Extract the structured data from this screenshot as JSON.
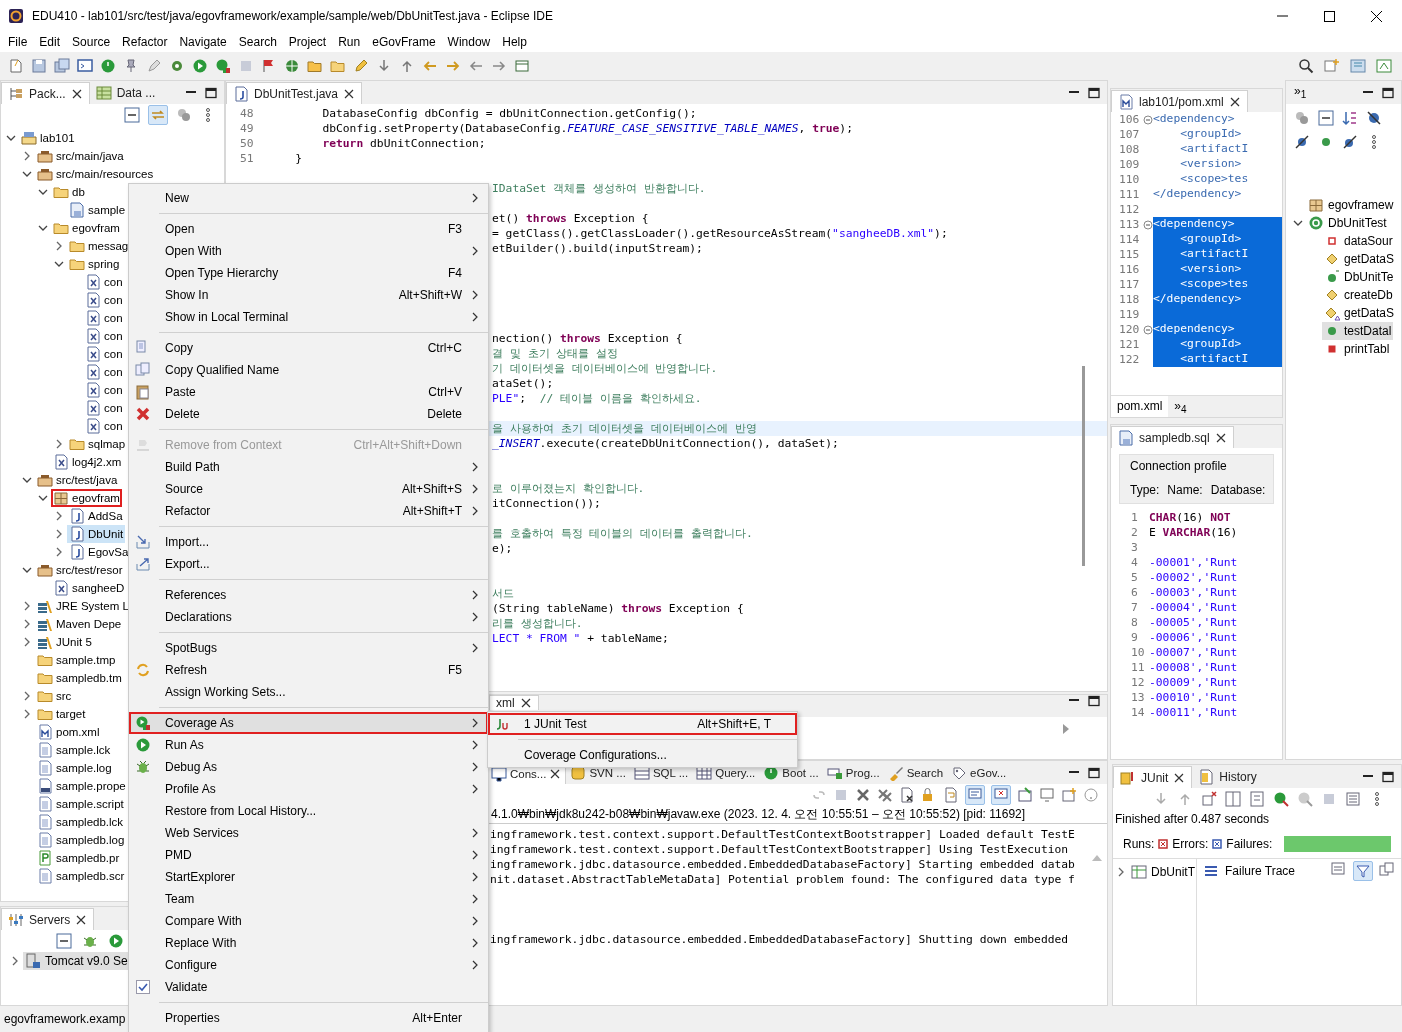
{
  "window": {
    "title": "EDU410 - lab101/src/test/java/egovframework/example/sample/web/DbUnitTest.java - Eclipse IDE"
  },
  "menu_bar": [
    "File",
    "Edit",
    "Source",
    "Refactor",
    "Navigate",
    "Search",
    "Project",
    "Run",
    "eGovFrame",
    "Window",
    "Help"
  ],
  "package_explorer": {
    "tabs": [
      {
        "label": "Pack...",
        "selected": true
      },
      {
        "label": "Data ...",
        "selected": false
      }
    ],
    "tree": [
      {
        "label": "lab101",
        "kind": "project",
        "expanded": true,
        "selected": false,
        "highlighted": false,
        "children": [
          {
            "label": "src/main/java",
            "kind": "srcfolder",
            "expanded": false,
            "selected": false,
            "highlighted": false
          },
          {
            "label": "src/main/resources",
            "kind": "srcfolder",
            "expanded": true,
            "selected": false,
            "highlighted": false,
            "children": [
              {
                "label": "db",
                "kind": "folder",
                "expanded": true,
                "selected": false,
                "highlighted": false,
                "children": [
                  {
                    "label": "sample",
                    "kind": "dbfile",
                    "selected": false,
                    "highlighted": false
                  }
                ]
              },
              {
                "label": "egovfram",
                "kind": "folder",
                "expanded": true,
                "selected": false,
                "highlighted": false,
                "children": [
                  {
                    "label": "messag",
                    "kind": "folder",
                    "expanded": false,
                    "selected": false,
                    "highlighted": false
                  },
                  {
                    "label": "spring",
                    "kind": "folder",
                    "expanded": true,
                    "selected": false,
                    "highlighted": false,
                    "children": [
                      {
                        "label": "con",
                        "kind": "xml",
                        "selected": false,
                        "highlighted": false
                      },
                      {
                        "label": "con",
                        "kind": "xml",
                        "selected": false,
                        "highlighted": false
                      },
                      {
                        "label": "con",
                        "kind": "xml",
                        "selected": false,
                        "highlighted": false
                      },
                      {
                        "label": "con",
                        "kind": "xml",
                        "selected": false,
                        "highlighted": false
                      },
                      {
                        "label": "con",
                        "kind": "xml",
                        "selected": false,
                        "highlighted": false
                      },
                      {
                        "label": "con",
                        "kind": "xml",
                        "selected": false,
                        "highlighted": false
                      },
                      {
                        "label": "con",
                        "kind": "xml",
                        "selected": false,
                        "highlighted": false
                      },
                      {
                        "label": "con",
                        "kind": "xml",
                        "selected": false,
                        "highlighted": false
                      },
                      {
                        "label": "con",
                        "kind": "xml",
                        "selected": false,
                        "highlighted": false
                      }
                    ]
                  },
                  {
                    "label": "sqlmap",
                    "kind": "folder",
                    "expanded": false,
                    "selected": false,
                    "highlighted": false
                  }
                ]
              },
              {
                "label": "log4j2.xm",
                "kind": "xml",
                "selected": false,
                "highlighted": false
              }
            ]
          },
          {
            "label": "src/test/java",
            "kind": "srcfolder",
            "expanded": true,
            "selected": false,
            "highlighted": false,
            "children": [
              {
                "label": "egovfram",
                "kind": "package",
                "expanded": true,
                "selected": false,
                "highlighted": true,
                "children": [
                  {
                    "label": "AddSa",
                    "kind": "java",
                    "expanded": false,
                    "selected": false,
                    "highlighted": false
                  },
                  {
                    "label": "DbUnit",
                    "kind": "java",
                    "expanded": false,
                    "selected": true,
                    "highlighted": false
                  },
                  {
                    "label": "EgovSa",
                    "kind": "java",
                    "expanded": false,
                    "selected": false,
                    "highlighted": false
                  }
                ]
              }
            ]
          },
          {
            "label": "src/test/resor",
            "kind": "srcfolder",
            "expanded": true,
            "selected": false,
            "highlighted": false,
            "children": [
              {
                "label": "sangheeD",
                "kind": "xml",
                "selected": false,
                "highlighted": false
              }
            ]
          },
          {
            "label": "JRE System L",
            "kind": "library",
            "expanded": false,
            "selected": false,
            "highlighted": false
          },
          {
            "label": "Maven Depe",
            "kind": "library",
            "expanded": false,
            "selected": false,
            "highlighted": false
          },
          {
            "label": "JUnit 5",
            "kind": "library",
            "expanded": false,
            "selected": false,
            "highlighted": false
          },
          {
            "label": "sample.tmp",
            "kind": "folder",
            "selected": false,
            "highlighted": false
          },
          {
            "label": "sampledb.tm",
            "kind": "folder",
            "selected": false,
            "highlighted": false
          },
          {
            "label": "src",
            "kind": "folder",
            "expanded": false,
            "selected": false,
            "highlighted": false
          },
          {
            "label": "target",
            "kind": "folder",
            "expanded": false,
            "selected": false,
            "highlighted": false
          },
          {
            "label": "pom.xml",
            "kind": "pom",
            "selected": false,
            "highlighted": false
          },
          {
            "label": "sample.lck",
            "kind": "file",
            "selected": false,
            "highlighted": false
          },
          {
            "label": "sample.log",
            "kind": "file",
            "selected": false,
            "highlighted": false
          },
          {
            "label": "sample.prope",
            "kind": "binary",
            "selected": false,
            "highlighted": false
          },
          {
            "label": "sample.script",
            "kind": "file",
            "selected": false,
            "highlighted": false
          },
          {
            "label": "sampledb.lck",
            "kind": "file",
            "selected": false,
            "highlighted": false
          },
          {
            "label": "sampledb.log",
            "kind": "file",
            "selected": false,
            "highlighted": false
          },
          {
            "label": "sampledb.pr",
            "kind": "pfile",
            "selected": false,
            "highlighted": false
          },
          {
            "label": "sampledb.scr",
            "kind": "file",
            "selected": false,
            "highlighted": false
          }
        ]
      }
    ]
  },
  "servers": {
    "tab": "Servers",
    "items": [
      {
        "label": "Tomcat v9.0 Se",
        "selected": true
      }
    ]
  },
  "editor": {
    "tab": "DbUnitTest.java",
    "lines": [
      {
        "number": "48",
        "current": false,
        "segments": [
          {
            "kind": "plain",
            "text": "        DatabaseConfig "
          },
          {
            "kind": "var",
            "text": "dbConfig"
          },
          {
            "kind": "plain",
            "text": " = "
          },
          {
            "kind": "var",
            "text": "dbUnitConnection"
          },
          {
            "kind": "plain",
            "text": ".getConfig();"
          }
        ]
      },
      {
        "number": "49",
        "current": false,
        "segments": [
          {
            "kind": "var",
            "text": "        dbConfig"
          },
          {
            "kind": "plain",
            "text": ".setProperty(DatabaseConfig."
          },
          {
            "kind": "const",
            "text": "FEATURE_CASE_SENSITIVE_TABLE_NAMES"
          },
          {
            "kind": "plain",
            "text": ", "
          },
          {
            "kind": "kw",
            "text": "true"
          },
          {
            "kind": "plain",
            "text": ");"
          }
        ]
      },
      {
        "number": "50",
        "current": false,
        "segments": [
          {
            "kind": "kw",
            "text": "        return "
          },
          {
            "kind": "var",
            "text": "dbUnitConnection"
          },
          {
            "kind": "plain",
            "text": ";"
          }
        ]
      },
      {
        "number": "51",
        "current": false,
        "segments": [
          {
            "kind": "plain",
            "text": "    }"
          }
        ]
      },
      {
        "current": false
      },
      {
        "current": false,
        "segments": [
          {
            "kind": "comment",
            "text": "IDataSet 객체를 생성하여 반환합니다."
          }
        ]
      },
      {
        "current": false
      },
      {
        "current": false,
        "segments": [
          {
            "kind": "plain",
            "text": "et() "
          },
          {
            "kind": "kw",
            "text": "throws"
          },
          {
            "kind": "plain",
            "text": " Exception {"
          }
        ]
      },
      {
        "current": false,
        "segments": [
          {
            "kind": "plain",
            "text": "= getClass().getClassLoader().getResourceAsStream("
          },
          {
            "kind": "str",
            "text": "\"sangheeDB.xml\""
          },
          {
            "kind": "plain",
            "text": ");"
          }
        ]
      },
      {
        "current": false,
        "segments": [
          {
            "kind": "plain",
            "text": "etBuilder().build("
          },
          {
            "kind": "var",
            "text": "inputStream"
          },
          {
            "kind": "plain",
            "text": ");"
          }
        ]
      },
      {
        "current": false
      },
      {
        "current": false
      },
      {
        "current": false
      },
      {
        "current": false
      },
      {
        "current": false
      },
      {
        "current": false,
        "segments": [
          {
            "kind": "plain",
            "text": "nection() "
          },
          {
            "kind": "kw",
            "text": "throws"
          },
          {
            "kind": "plain",
            "text": " Exception {"
          }
        ]
      },
      {
        "current": false,
        "segments": [
          {
            "kind": "comment",
            "text": "결 및 초기 상태를 설정"
          }
        ]
      },
      {
        "current": false,
        "segments": [
          {
            "kind": "comment",
            "text": "기 데이터셋을 데이터베이스에 반영합니다."
          }
        ]
      },
      {
        "current": false,
        "segments": [
          {
            "kind": "plain",
            "text": "ataSet();"
          }
        ]
      },
      {
        "current": false,
        "segments": [
          {
            "kind": "str",
            "text": "PLE\""
          },
          {
            "kind": "plain",
            "text": ";  "
          },
          {
            "kind": "comment",
            "text": "// 테이블 이름을 확인하세요."
          }
        ]
      },
      {
        "current": false
      },
      {
        "current": true,
        "segments": [
          {
            "kind": "comment",
            "text": "을 사용하여 초기 데이터셋을 데이터베이스에 반영"
          }
        ]
      },
      {
        "current": false,
        "segments": [
          {
            "kind": "const",
            "text": "_INSERT"
          },
          {
            "kind": "plain",
            "text": ".execute(createDbUnitConnection(), "
          },
          {
            "kind": "var",
            "text": "dataSet"
          },
          {
            "kind": "plain",
            "text": ");"
          }
        ]
      },
      {
        "current": false
      },
      {
        "current": false
      },
      {
        "current": false,
        "segments": [
          {
            "kind": "comment",
            "text": "로 이루어졌는지 확인합니다."
          }
        ]
      },
      {
        "current": false,
        "segments": [
          {
            "kind": "plain",
            "text": "itConnection());"
          }
        ]
      },
      {
        "current": false
      },
      {
        "current": false,
        "segments": [
          {
            "kind": "comment",
            "text": "를 호출하여 특정 테이블의 데이터를 출력합니다."
          }
        ]
      },
      {
        "current": false,
        "segments": [
          {
            "kind": "plain",
            "text": "e);"
          }
        ]
      },
      {
        "current": false
      },
      {
        "current": false
      },
      {
        "current": false,
        "segments": [
          {
            "kind": "comment",
            "text": "서드"
          }
        ]
      },
      {
        "current": false,
        "segments": [
          {
            "kind": "plain",
            "text": "(String "
          },
          {
            "kind": "var",
            "text": "tableName"
          },
          {
            "kind": "plain",
            "text": ") "
          },
          {
            "kind": "kw",
            "text": "throws"
          },
          {
            "kind": "plain",
            "text": " Exception {"
          }
        ]
      },
      {
        "current": false,
        "segments": [
          {
            "kind": "comment",
            "text": "리를 생성합니다."
          }
        ]
      },
      {
        "current": false,
        "segments": [
          {
            "kind": "str",
            "text": "LECT * FROM \""
          },
          {
            "kind": "plain",
            "text": " + "
          },
          {
            "kind": "var",
            "text": "tableName"
          },
          {
            "kind": "plain",
            "text": ";"
          }
        ]
      }
    ]
  },
  "lower_editor": {
    "tab": "xml"
  },
  "pom_editor": {
    "tab": "lab101/pom.xml",
    "lines": [
      {
        "number": "106",
        "text": "<dependency>",
        "selected": false,
        "folding": true
      },
      {
        "number": "107",
        "text": "    <groupId>",
        "selected": false,
        "folding": false
      },
      {
        "number": "108",
        "text": "    <artifactI",
        "selected": false,
        "folding": false
      },
      {
        "number": "109",
        "text": "    <version>",
        "selected": false,
        "folding": false
      },
      {
        "number": "110",
        "text": "    <scope>tes",
        "selected": false,
        "folding": false
      },
      {
        "number": "111",
        "text": "</dependency>",
        "selected": false,
        "folding": false
      },
      {
        "number": "112",
        "selected": false,
        "folding": false
      },
      {
        "number": "113",
        "text": "<dependency>",
        "selected": true,
        "folding": true
      },
      {
        "number": "114",
        "text": "    <groupId>",
        "selected": true,
        "folding": false
      },
      {
        "number": "115",
        "text": "    <artifactI",
        "selected": true,
        "folding": false
      },
      {
        "number": "116",
        "text": "    <version>",
        "selected": true,
        "folding": false
      },
      {
        "number": "117",
        "text": "    <scope>tes",
        "selected": true,
        "folding": false
      },
      {
        "number": "118",
        "text": "</dependency>",
        "selected": true,
        "folding": false
      },
      {
        "number": "119",
        "selected": true,
        "folding": false
      },
      {
        "number": "120",
        "text": "<dependency>",
        "selected": true,
        "folding": true
      },
      {
        "number": "121",
        "text": "    <groupId>",
        "selected": true,
        "folding": false
      },
      {
        "number": "122",
        "text": "    <artifactI",
        "selected": true,
        "folding": false
      }
    ],
    "bottom_tabs": [
      {
        "label": "pom.xml",
        "selected": true
      },
      {
        "label": "»$_{4}$",
        "selected": false
      }
    ]
  },
  "sql_editor": {
    "tab": "sampledb.sql",
    "connection_profile": {
      "title": "Connection profile",
      "fields": [
        "Type:",
        "Name:",
        "Database:"
      ]
    },
    "lines": [
      {
        "number": "1",
        "segments": [
          {
            "kind": "kw",
            "text": "CHAR"
          },
          {
            "kind": "plain",
            "text": "(16) "
          },
          {
            "kind": "kw",
            "text": "NOT"
          }
        ]
      },
      {
        "number": "2",
        "segments": [
          {
            "kind": "plain",
            "text": "E "
          },
          {
            "kind": "kw",
            "text": "VARCHAR"
          },
          {
            "kind": "plain",
            "text": "(16)"
          }
        ]
      },
      {
        "number": "3"
      },
      {
        "number": "4",
        "segments": [
          {
            "kind": "str",
            "text": "-00001','Runt"
          }
        ]
      },
      {
        "number": "5",
        "segments": [
          {
            "kind": "str",
            "text": "-00002','Runt"
          }
        ]
      },
      {
        "number": "6",
        "segments": [
          {
            "kind": "str",
            "text": "-00003','Runt"
          }
        ]
      },
      {
        "number": "7",
        "segments": [
          {
            "kind": "str",
            "text": "-00004','Runt"
          }
        ]
      },
      {
        "number": "8",
        "segments": [
          {
            "kind": "str",
            "text": "-00005','Runt"
          }
        ]
      },
      {
        "number": "9",
        "segments": [
          {
            "kind": "str",
            "text": "-00006','Runt"
          }
        ]
      },
      {
        "number": "10",
        "segments": [
          {
            "kind": "str",
            "text": "-00007','Runt"
          }
        ]
      },
      {
        "number": "11",
        "segments": [
          {
            "kind": "str",
            "text": "-00008','Runt"
          }
        ]
      },
      {
        "number": "12",
        "segments": [
          {
            "kind": "str",
            "text": "-00009','Runt"
          }
        ]
      },
      {
        "number": "13",
        "segments": [
          {
            "kind": "str",
            "text": "-00010','Runt"
          }
        ]
      },
      {
        "number": "14",
        "segments": [
          {
            "kind": "str",
            "text": "-00011','Runt"
          }
        ]
      }
    ]
  },
  "outline": {
    "tab": "»$_{1}$",
    "items": [
      {
        "label": "egovframew",
        "kind": "package",
        "selected": false
      },
      {
        "label": "DbUnitTest",
        "kind": "class",
        "expanded": true,
        "selected": false,
        "children": [
          {
            "label": "dataSour",
            "kind": "field",
            "selected": false
          },
          {
            "label": "getDataS",
            "kind": "method",
            "selected": false
          },
          {
            "label": "DbUnitTe",
            "kind": "constructor",
            "selected": false
          },
          {
            "label": "createDb",
            "kind": "method",
            "selected": false
          },
          {
            "label": "getDataS",
            "kind": "abstract",
            "selected": false
          },
          {
            "label": "testDatal",
            "kind": "public",
            "selected": true
          },
          {
            "label": "printTabl",
            "kind": "private",
            "selected": false
          }
        ]
      }
    ]
  },
  "console": {
    "tabs": [
      {
        "label": "Cons...",
        "selected": true
      },
      {
        "label": "SVN ...",
        "selected": false
      },
      {
        "label": "SQL ...",
        "selected": false
      },
      {
        "label": "Query...",
        "selected": false
      },
      {
        "label": "Boot ...",
        "selected": false
      },
      {
        "label": "Prog...",
        "selected": false
      },
      {
        "label": "Search",
        "selected": false
      },
      {
        "label": "eGov...",
        "selected": false
      }
    ],
    "header": "4.1.0₩bin₩jdk8u242-b08₩bin₩javaw.exe  (2023. 12. 4. 오전 10:55:51 – 오전 10:55:52) [pid: 11692]",
    "lines": [
      {
        "text": "ingframework.test.context.support.DefaultTestContextBootstrapper] Loaded default TestE"
      },
      {
        "text": "ingframework.test.context.support.DefaultTestContextBootstrapper] Using TestExecution"
      },
      {
        "text": "ingframework.jdbc.datasource.embedded.EmbeddedDatabaseFactory] Starting embedded datab"
      },
      {
        "text": "nit.dataset.AbstractTableMetaData] Potential problem found: The configured data type f"
      }
    ],
    "later_lines": [
      {
        "text": "ingframework.jdbc.datasource.embedded.EmbeddedDatabaseFactory] Shutting down embedded"
      }
    ]
  },
  "junit": {
    "tabs": [
      {
        "label": "JUnit",
        "selected": true
      },
      {
        "label": "History",
        "selected": false
      }
    ],
    "status": "Finished after 0.487 seconds",
    "runs_label": "Runs:",
    "errors_label": "Errors:",
    "failures_label": "Failures:",
    "level": 1,
    "tree": [
      {
        "label": "DbUnitT",
        "expanded": false
      }
    ],
    "failure_trace": "Failure Trace"
  },
  "context_menu": {
    "items": [
      {
        "kind": "item",
        "label": "New",
        "submenu": true,
        "disabled": false,
        "selected": false,
        "highlighted": false
      },
      {
        "kind": "separator"
      },
      {
        "kind": "item",
        "label": "Open",
        "shortcut": "F3",
        "submenu": false,
        "disabled": false,
        "selected": false,
        "highlighted": false
      },
      {
        "kind": "item",
        "label": "Open With",
        "submenu": true,
        "disabled": false,
        "selected": false,
        "highlighted": false
      },
      {
        "kind": "item",
        "label": "Open Type Hierarchy",
        "shortcut": "F4",
        "submenu": false,
        "disabled": false,
        "selected": false,
        "highlighted": false
      },
      {
        "kind": "item",
        "label": "Show In",
        "shortcut": "Alt+Shift+W",
        "submenu": true,
        "disabled": false,
        "selected": false,
        "highlighted": false
      },
      {
        "kind": "item",
        "label": "Show in Local Terminal",
        "submenu": true,
        "disabled": false,
        "selected": false,
        "highlighted": false
      },
      {
        "kind": "separator"
      },
      {
        "kind": "item",
        "label": "Copy",
        "shortcut": "Ctrl+C",
        "submenu": false,
        "disabled": false,
        "selected": false,
        "highlighted": false
      },
      {
        "kind": "item",
        "label": "Copy Qualified Name",
        "submenu": false,
        "disabled": false,
        "selected": false,
        "highlighted": false
      },
      {
        "kind": "item",
        "label": "Paste",
        "shortcut": "Ctrl+V",
        "submenu": false,
        "disabled": false,
        "selected": false,
        "highlighted": false
      },
      {
        "kind": "item",
        "label": "Delete",
        "shortcut": "Delete",
        "submenu": false,
        "disabled": false,
        "selected": false,
        "highlighted": false
      },
      {
        "kind": "separator"
      },
      {
        "kind": "item",
        "label": "Remove from Context",
        "shortcut": "Ctrl+Alt+Shift+Down",
        "submenu": false,
        "disabled": true,
        "selected": false,
        "highlighted": false
      },
      {
        "kind": "item",
        "label": "Build Path",
        "submenu": true,
        "disabled": false,
        "selected": false,
        "highlighted": false
      },
      {
        "kind": "item",
        "label": "Source",
        "shortcut": "Alt+Shift+S",
        "submenu": true,
        "disabled": false,
        "selected": false,
        "highlighted": false
      },
      {
        "kind": "item",
        "label": "Refactor",
        "shortcut": "Alt+Shift+T",
        "submenu": true,
        "disabled": false,
        "selected": false,
        "highlighted": false
      },
      {
        "kind": "separator"
      },
      {
        "kind": "item",
        "label": "Import...",
        "submenu": false,
        "disabled": false,
        "selected": false,
        "highlighted": false
      },
      {
        "kind": "item",
        "label": "Export...",
        "submenu": false,
        "disabled": false,
        "selected": false,
        "highlighted": false
      },
      {
        "kind": "separator"
      },
      {
        "kind": "item",
        "label": "References",
        "submenu": true,
        "disabled": false,
        "selected": false,
        "highlighted": false
      },
      {
        "kind": "item",
        "label": "Declarations",
        "submenu": true,
        "disabled": false,
        "selected": false,
        "highlighted": false
      },
      {
        "kind": "separator"
      },
      {
        "kind": "item",
        "label": "SpotBugs",
        "submenu": true,
        "disabled": false,
        "selected": false,
        "highlighted": false
      },
      {
        "kind": "item",
        "label": "Refresh",
        "shortcut": "F5",
        "submenu": false,
        "disabled": false,
        "selected": false,
        "highlighted": false
      },
      {
        "kind": "item",
        "label": "Assign Working Sets...",
        "submenu": false,
        "disabled": false,
        "selected": false,
        "highlighted": false
      },
      {
        "kind": "separator"
      },
      {
        "kind": "item",
        "label": "Coverage As",
        "submenu": true,
        "disabled": false,
        "selected": true,
        "highlighted": true
      },
      {
        "kind": "item",
        "label": "Run As",
        "submenu": true,
        "disabled": false,
        "selected": false,
        "highlighted": false
      },
      {
        "kind": "item",
        "label": "Debug As",
        "submenu": true,
        "disabled": false,
        "selected": false,
        "highlighted": false
      },
      {
        "kind": "item",
        "label": "Profile As",
        "submenu": true,
        "disabled": false,
        "selected": false,
        "highlighted": false
      },
      {
        "kind": "item",
        "label": "Restore from Local History...",
        "submenu": false,
        "disabled": false,
        "selected": false,
        "highlighted": false
      },
      {
        "kind": "item",
        "label": "Web Services",
        "submenu": true,
        "disabled": false,
        "selected": false,
        "highlighted": false
      },
      {
        "kind": "item",
        "label": "PMD",
        "submenu": true,
        "disabled": false,
        "selected": false,
        "highlighted": false
      },
      {
        "kind": "item",
        "label": "StartExplorer",
        "submenu": true,
        "disabled": false,
        "selected": false,
        "highlighted": false
      },
      {
        "kind": "item",
        "label": "Team",
        "submenu": true,
        "disabled": false,
        "selected": false,
        "highlighted": false
      },
      {
        "kind": "item",
        "label": "Compare With",
        "submenu": true,
        "disabled": false,
        "selected": false,
        "highlighted": false
      },
      {
        "kind": "item",
        "label": "Replace With",
        "submenu": true,
        "disabled": false,
        "selected": false,
        "highlighted": false
      },
      {
        "kind": "item",
        "label": "Configure",
        "submenu": true,
        "disabled": false,
        "selected": false,
        "highlighted": false
      },
      {
        "kind": "item",
        "label": "Validate",
        "submenu": false,
        "disabled": false,
        "selected": false,
        "highlighted": false
      },
      {
        "kind": "separator"
      },
      {
        "kind": "item",
        "label": "Properties",
        "shortcut": "Alt+Enter",
        "submenu": false,
        "disabled": false,
        "selected": false,
        "highlighted": false
      }
    ]
  },
  "submenu": {
    "items": [
      {
        "kind": "item",
        "label": "1 JUnit Test",
        "shortcut": "Alt+Shift+E, T",
        "highlighted": true
      },
      {
        "kind": "separator"
      },
      {
        "kind": "item",
        "label": "Coverage Configurations...",
        "highlighted": false
      }
    ]
  },
  "status_bar": {
    "text": "egovframework.examp"
  }
}
